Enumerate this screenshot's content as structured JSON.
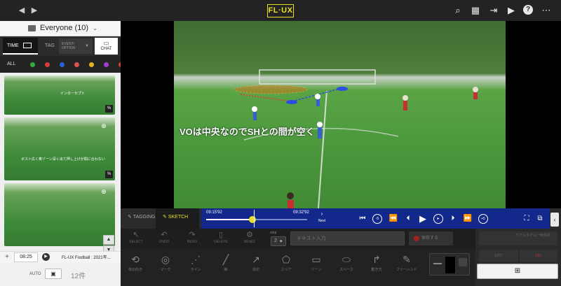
{
  "app": {
    "logo": "FL·UX"
  },
  "nav": {
    "back_label": "◀",
    "forward_label": "▶"
  },
  "top_icons": [
    "search-list-icon",
    "calendar-icon",
    "share-icon",
    "play-list-icon",
    "help-icon",
    "more-icon"
  ],
  "group": {
    "selected": "Everyone (10)"
  },
  "tabs": {
    "time": "TIME",
    "tag": "TAG",
    "event_option": "EVENT/\nOPTION",
    "chat": "CHAT"
  },
  "filter": {
    "all_label": "ALL",
    "colors": [
      "#2fae3a",
      "#d93a3a",
      "#2a5fd6",
      "#e05050",
      "#e2b21f",
      "#a23ed1",
      "#e03b3b"
    ]
  },
  "thumbnails": [
    {
      "overlay": "インターセプト"
    },
    {
      "overlay": "ボスト広く奥ゾーン深く出て押し上げが間に合わない"
    },
    {
      "overlay": ""
    }
  ],
  "bottom_left": {
    "time": "08:25",
    "title": "FL-UX Football : 2021年..."
  },
  "auto_row": {
    "auto_label": "AUTO",
    "count": "12件"
  },
  "video": {
    "caption": "VOは中央なのでSHとの間が空く"
  },
  "controls": {
    "tagging": "TAGGING",
    "sketch": "SKETCH",
    "time_start": "09:15'92",
    "time_end": "09:32'92",
    "next_label": "Next",
    "progress": 0.46
  },
  "tool_row1": {
    "select": "SELECT",
    "undo": "UNDO",
    "redo": "REDO",
    "delete": "DELETE",
    "reset": "RESET",
    "step_label": "step",
    "step_value": "2",
    "text_placeholder": "テキスト入力",
    "save_label": "保存する"
  },
  "tool_row2": [
    "体の向き",
    "マーク",
    "ライン",
    "線",
    "矢印",
    "エリア",
    "ゾーン",
    "スペース",
    "動き方",
    "フリーハンド"
  ],
  "right_panel": {
    "realtime": "リアルタイム一時保存",
    "exit": "EXIT",
    "del": "DEL"
  }
}
